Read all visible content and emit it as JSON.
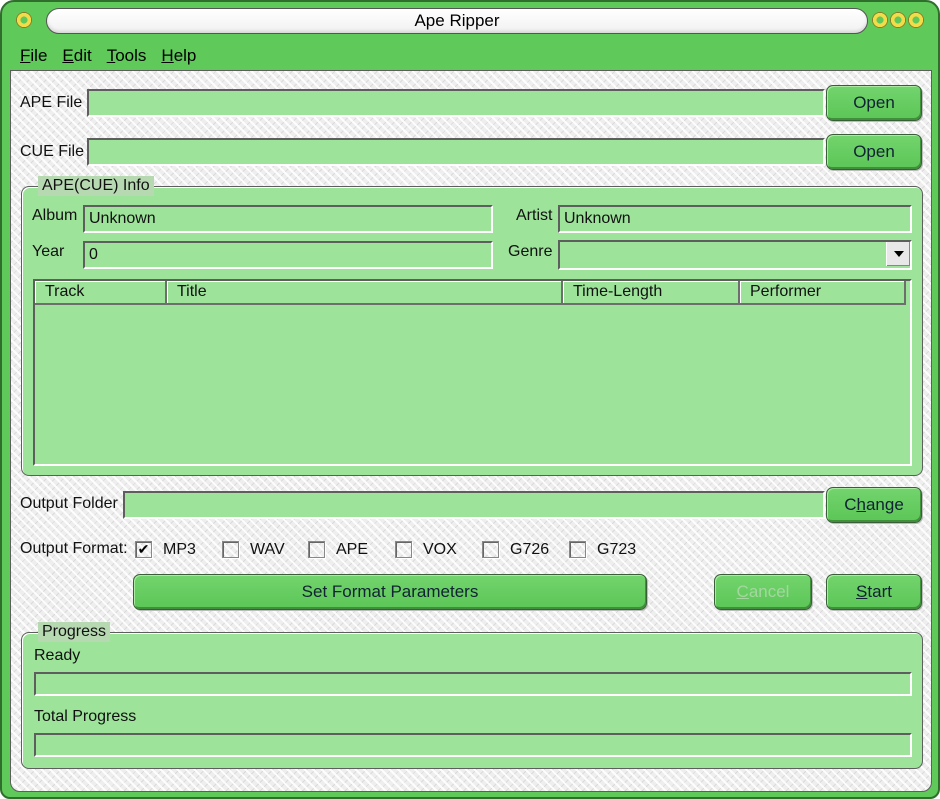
{
  "window": {
    "title": "Ape Ripper"
  },
  "menu": [
    {
      "label": "File",
      "accel": "F",
      "rest": "ile"
    },
    {
      "label": "Edit",
      "accel": "E",
      "rest": "dit"
    },
    {
      "label": "Tools",
      "accel": "T",
      "rest": "ools"
    },
    {
      "label": "Help",
      "accel": "H",
      "rest": "elp"
    }
  ],
  "files": {
    "ape_label": "APE File",
    "ape_value": "",
    "ape_open": "Open",
    "cue_label": "CUE File",
    "cue_value": "",
    "cue_open": "Open"
  },
  "info": {
    "title": "APE(CUE) Info",
    "album_label": "Album",
    "album_value": "Unknown",
    "artist_label": "Artist",
    "artist_value": "Unknown",
    "year_label": "Year",
    "year_value": "0",
    "genre_label": "Genre",
    "genre_value": "",
    "columns": [
      "Track",
      "Title",
      "Time-Length",
      "Performer"
    ],
    "rows": []
  },
  "output": {
    "folder_label": "Output Folder",
    "folder_value": "",
    "change_label": "Change",
    "change_accel_index": 1,
    "format_label": "Output Format:",
    "formats": [
      {
        "label": "MP3",
        "checked": true
      },
      {
        "label": "WAV",
        "checked": false
      },
      {
        "label": "APE",
        "checked": false
      },
      {
        "label": "VOX",
        "checked": false
      },
      {
        "label": "G726",
        "checked": false
      },
      {
        "label": "G723",
        "checked": false
      }
    ]
  },
  "actions": {
    "set_params": "Set Format Parameters",
    "cancel": "Cancel",
    "cancel_enabled": false,
    "start": "Start"
  },
  "progress": {
    "title": "Progress",
    "status": "Ready",
    "current_fraction": 0,
    "total_label": "Total Progress",
    "total_fraction": 0
  },
  "colors": {
    "chrome_green": "#5fc95a",
    "field_green": "#9de39a",
    "button_green": "#66cc61"
  }
}
